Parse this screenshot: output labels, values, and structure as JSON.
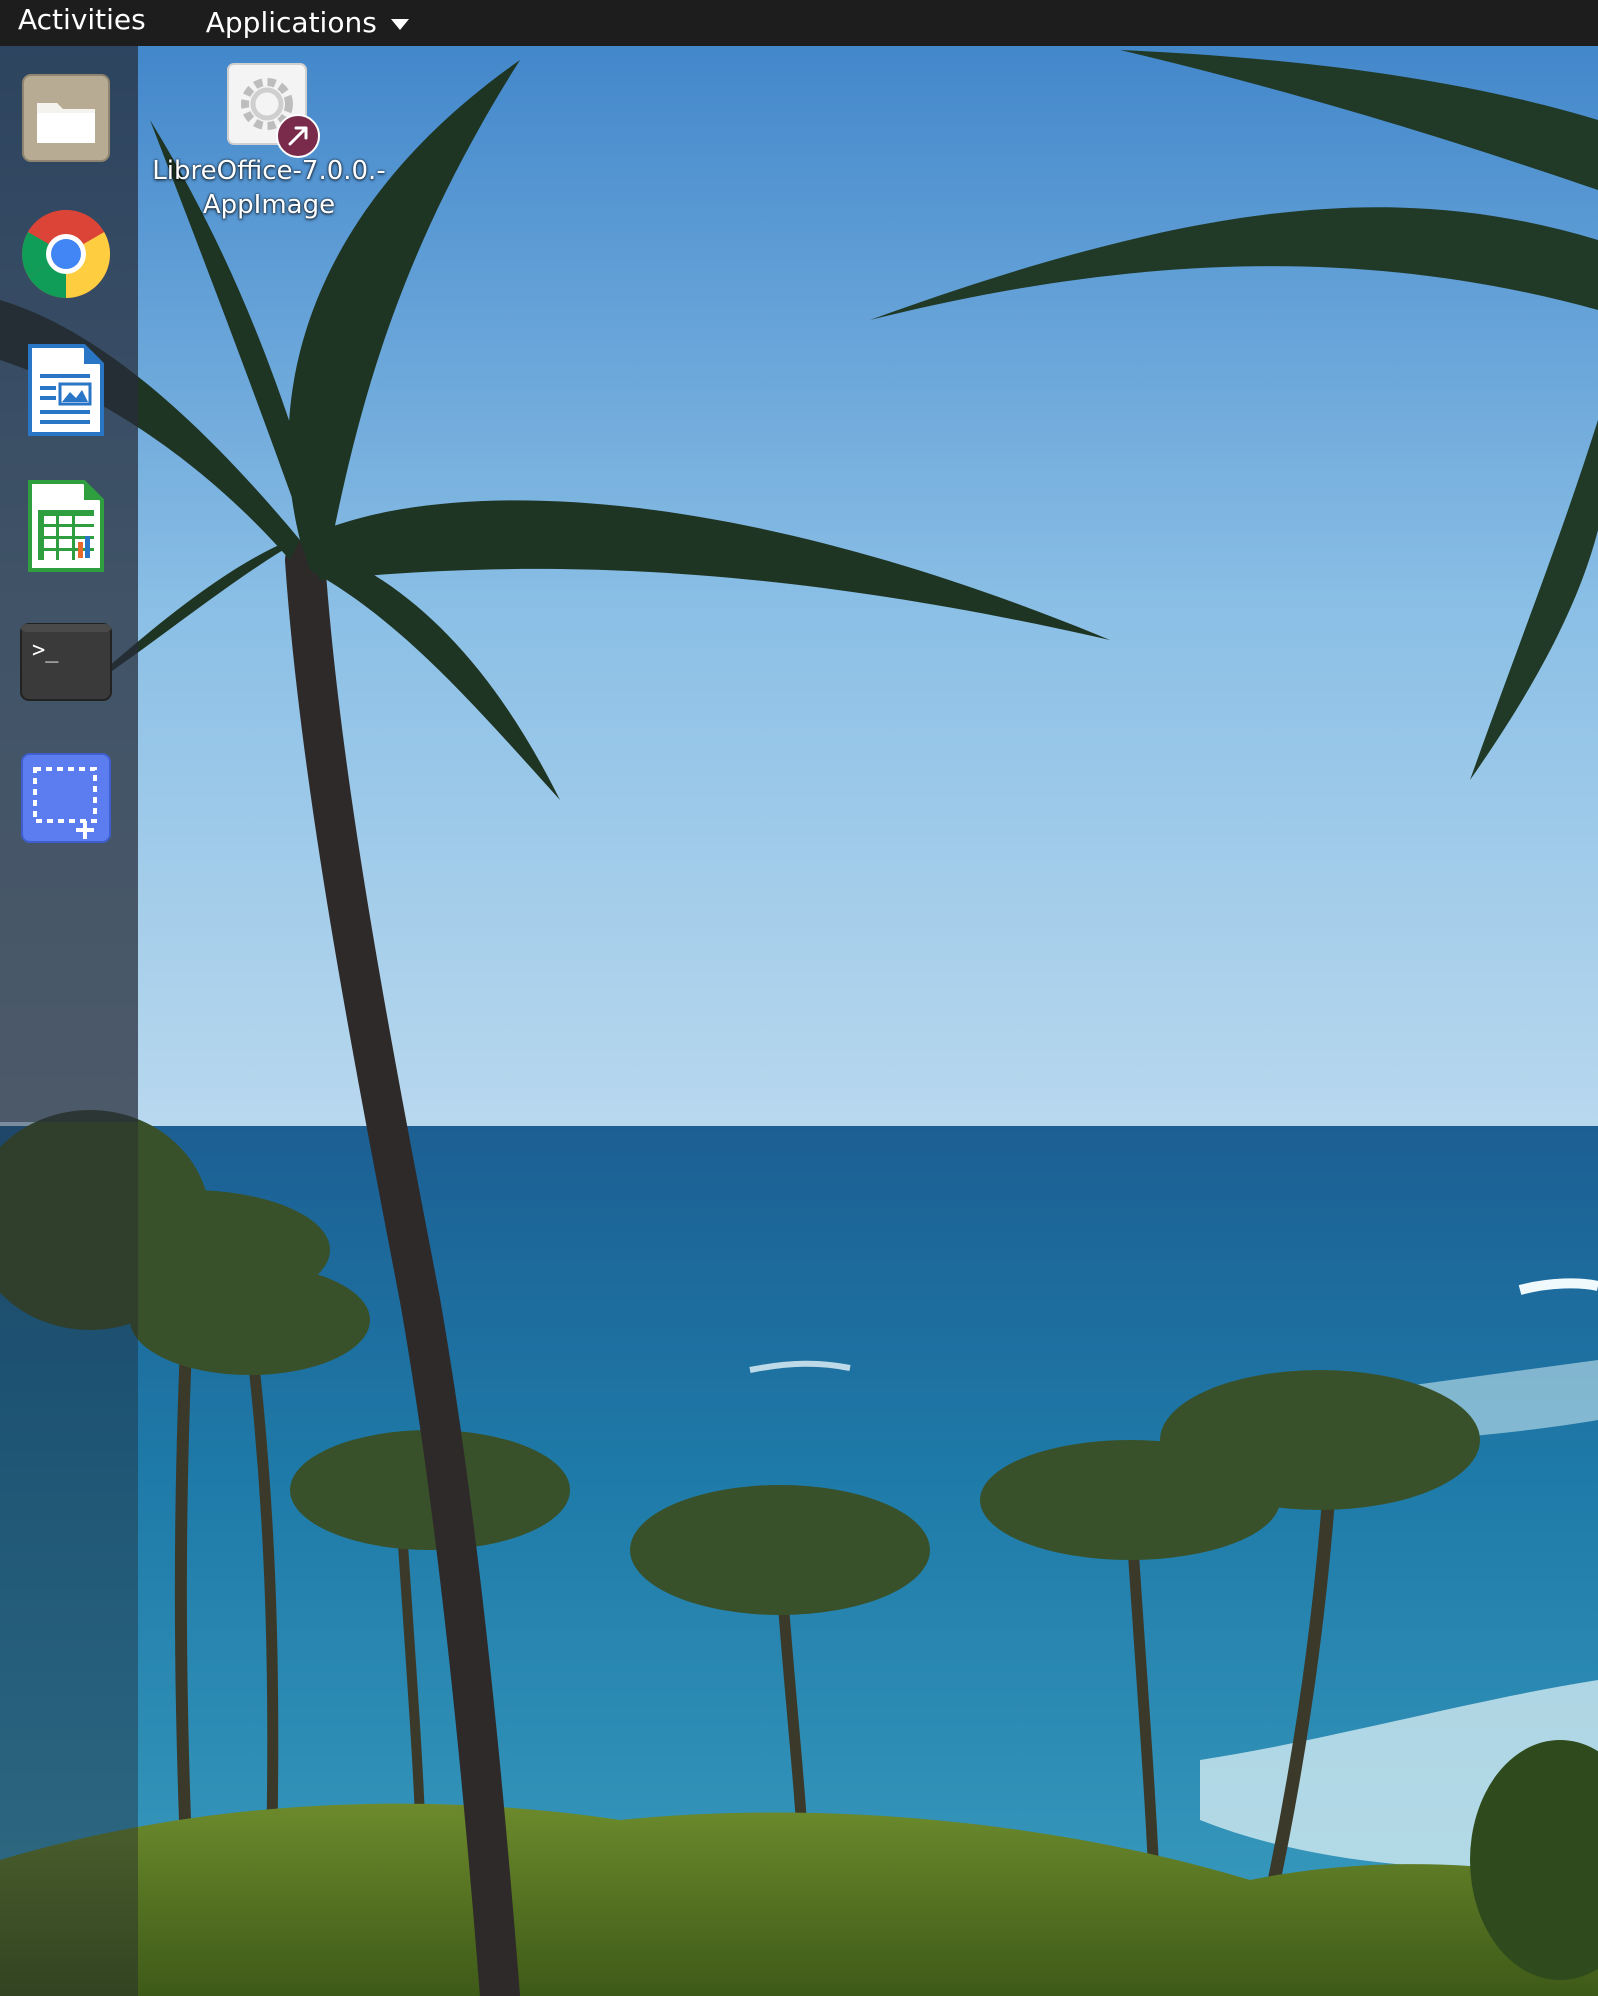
{
  "topbar": {
    "activities_label": "Activities",
    "applications_label": "Applications"
  },
  "dock": {
    "items": [
      {
        "name": "files",
        "icon": "files-icon"
      },
      {
        "name": "google-chrome",
        "icon": "chrome-icon"
      },
      {
        "name": "libreoffice-writer",
        "icon": "writer-icon"
      },
      {
        "name": "libreoffice-calc",
        "icon": "calc-icon"
      },
      {
        "name": "terminal",
        "icon": "terminal-icon",
        "glyph": ">_"
      },
      {
        "name": "screenshot",
        "icon": "screenshot-icon"
      }
    ]
  },
  "desktop": {
    "icons": [
      {
        "label_line1": "LibreOffice-7.0.0.-",
        "label_line2": "AppImage",
        "icon": "appimage-gear-icon",
        "badge": "symlink-arrow-icon"
      }
    ]
  },
  "colors": {
    "topbar_bg": "#1d1d1d",
    "symlink_badge": "#7a2a4a",
    "calc_green": "#2e9e3f",
    "writer_blue": "#2a76c6",
    "screenshot_blue": "#5b7df0"
  }
}
